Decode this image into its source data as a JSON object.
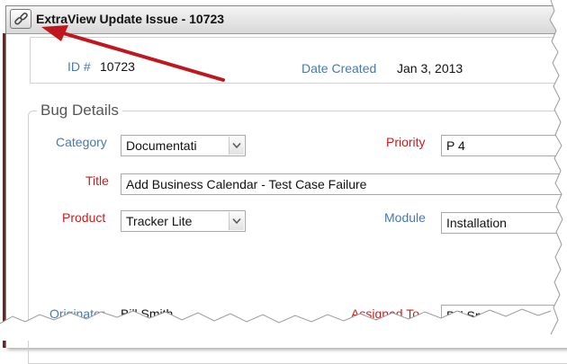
{
  "window": {
    "title": "ExtraView Update Issue - 10723",
    "link_icon": "link-icon"
  },
  "header": {
    "id_label": "ID #",
    "id_value": "10723",
    "date_label": "Date Created",
    "date_value": "Jan 3, 2013"
  },
  "section": {
    "legend": "Bug Details"
  },
  "fields": {
    "category_label": "Category",
    "category_value": "Documentati",
    "priority_label": "Priority",
    "priority_value": "P 4",
    "title_label": "Title",
    "title_value": "Add Business Calendar - Test Case Failure",
    "product_label": "Product",
    "product_value": "Tracker Lite",
    "module_label": "Module",
    "module_value": "Installation",
    "originator_label": "Originator",
    "originator_value": "Bill Smith",
    "assigned_label": "Assigned To",
    "assigned_value": "Bill Smith"
  },
  "colors": {
    "label_blue": "#4a79a8",
    "label_red": "#c81e1e",
    "annotation_arrow": "#c0171f"
  }
}
